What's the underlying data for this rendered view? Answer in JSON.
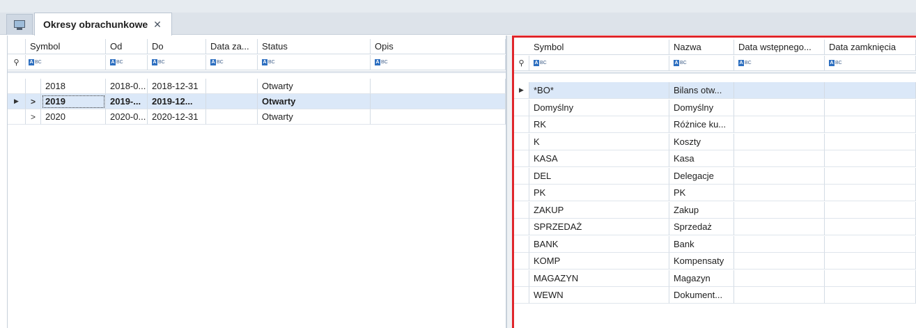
{
  "tabs": {
    "home_icon": "monitor-icon",
    "active_tab": "Okresy obrachunkowe",
    "close_glyph": "✕"
  },
  "left_grid": {
    "columns": [
      "Symbol",
      "Od",
      "Do",
      "Data za...",
      "Status",
      "Opis"
    ],
    "rows": [
      {
        "symbol": "2018",
        "od": "2018-0...",
        "do": "2018-12-31",
        "data_za": "",
        "status": "Otwarty",
        "opis": "",
        "expander": "",
        "indicator": ""
      },
      {
        "symbol": "2019",
        "od": "2019-...",
        "do": "2019-12...",
        "data_za": "",
        "status": "Otwarty",
        "opis": "",
        "expander": ">",
        "indicator": "▶"
      },
      {
        "symbol": "2020",
        "od": "2020-0...",
        "do": "2020-12-31",
        "data_za": "",
        "status": "Otwarty",
        "opis": "",
        "expander": ">",
        "indicator": ""
      }
    ],
    "selected_row": 1
  },
  "right_grid": {
    "columns": [
      "Symbol",
      "Nazwa",
      "Data wstępnego...",
      "Data zamknięcia"
    ],
    "rows": [
      {
        "symbol": "*BO*",
        "nazwa": "Bilans otw...",
        "indicator": "▶"
      },
      {
        "symbol": "Domyślny",
        "nazwa": "Domyślny",
        "indicator": ""
      },
      {
        "symbol": "RK",
        "nazwa": "Różnice ku...",
        "indicator": ""
      },
      {
        "symbol": "K",
        "nazwa": "Koszty",
        "indicator": ""
      },
      {
        "symbol": "KASA",
        "nazwa": "Kasa",
        "indicator": ""
      },
      {
        "symbol": "DEL",
        "nazwa": "Delegacje",
        "indicator": ""
      },
      {
        "symbol": "PK",
        "nazwa": "PK",
        "indicator": ""
      },
      {
        "symbol": "ZAKUP",
        "nazwa": "Zakup",
        "indicator": ""
      },
      {
        "symbol": "SPRZEDAŻ",
        "nazwa": "Sprzedaż",
        "indicator": ""
      },
      {
        "symbol": "BANK",
        "nazwa": "Bank",
        "indicator": ""
      },
      {
        "symbol": "KOMP",
        "nazwa": "Kompensaty",
        "indicator": ""
      },
      {
        "symbol": "MAGAZYN",
        "nazwa": "Magazyn",
        "indicator": ""
      },
      {
        "symbol": "WEWN",
        "nazwa": "Dokument...",
        "indicator": ""
      }
    ]
  },
  "filter_icon_text": "ABC",
  "highlight_color": "#e0262b",
  "selection_color": "#dbe8f8"
}
